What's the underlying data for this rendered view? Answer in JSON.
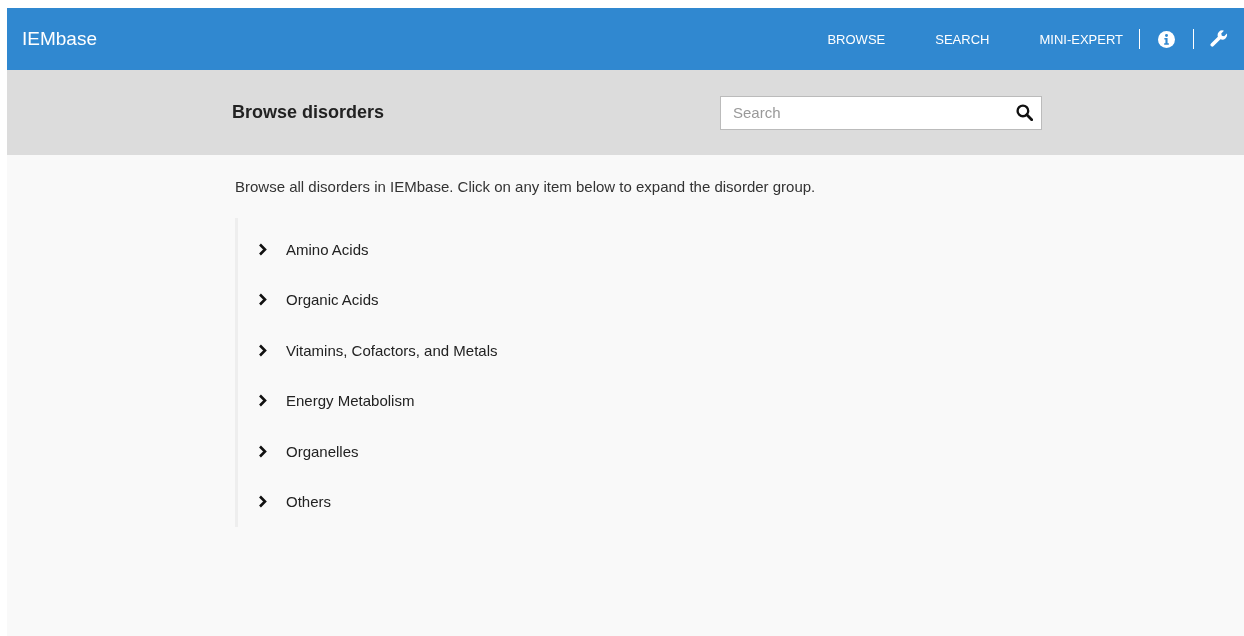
{
  "header": {
    "logo": "IEMbase",
    "nav": [
      "BROWSE",
      "SEARCH",
      "MINI-EXPERT"
    ]
  },
  "browse_bar": {
    "title": "Browse disorders",
    "search": {
      "placeholder": "Search"
    }
  },
  "intro": "Browse all disorders in IEMbase. Click on any item below to expand the disorder group.",
  "groups": [
    {
      "label": "Amino Acids",
      "expanded": false
    },
    {
      "label": "Organic Acids",
      "expanded": false
    },
    {
      "label": "Vitamins, Cofactors, and Metals",
      "expanded": false
    },
    {
      "label": "Energy Metabolism",
      "expanded": false
    },
    {
      "label": "Organelles",
      "expanded": false
    },
    {
      "label": "Others",
      "expanded": false
    }
  ]
}
